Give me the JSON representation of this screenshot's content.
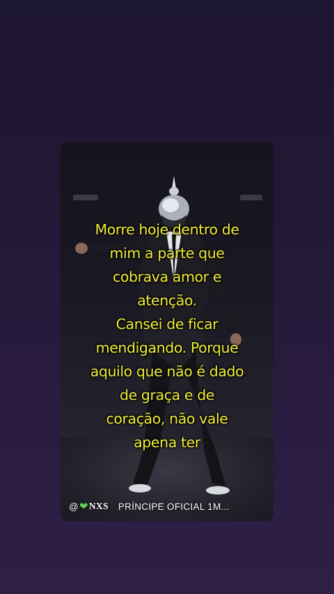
{
  "caption": {
    "lines": [
      "Morre hoje dentro de",
      "mim a parte que",
      "cobrava amor e",
      "atenção.",
      "Cansei de ficar",
      "mendigando. Porque",
      "aquilo que não é dado",
      "de graça e de",
      "coração, não vale",
      "apena ter"
    ],
    "color": "#f2ef3a"
  },
  "footer": {
    "handle_prefix": "@",
    "heart_icon": "green-heart-icon",
    "handle_suffix": "NXS",
    "channel_text": "PRÍNCIPE OFICIAL 1M..."
  },
  "colors": {
    "background": "#241a38",
    "card": "#1a1822",
    "caption_text": "#f2ef3a",
    "heart": "#5fd05a"
  }
}
